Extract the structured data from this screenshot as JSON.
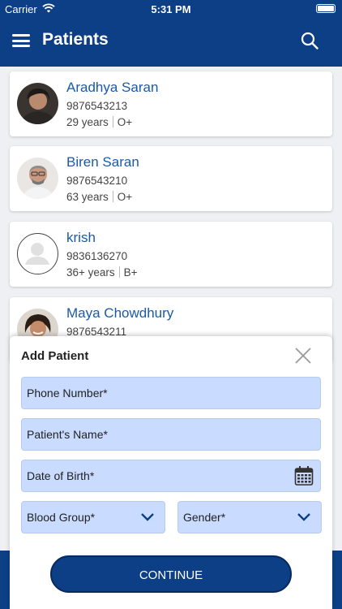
{
  "status_bar": {
    "carrier": "Carrier",
    "time": "5:31 PM"
  },
  "nav": {
    "title": "Patients"
  },
  "patients": [
    {
      "name": "Aradhya Saran",
      "phone": "9876543213",
      "age": "29 years",
      "blood": "O+"
    },
    {
      "name": "Biren Saran",
      "phone": "9876543210",
      "age": "63 years",
      "blood": "O+"
    },
    {
      "name": "krish",
      "phone": "9836136270",
      "age": "36+ years",
      "blood": "B+"
    },
    {
      "name": "Maya Chowdhury",
      "phone": "9876543211",
      "age": "",
      "blood": ""
    }
  ],
  "modal": {
    "title": "Add Patient",
    "phone_label": "Phone Number*",
    "name_label": "Patient's Name*",
    "dob_label": "Date of Birth*",
    "blood_label": "Blood Group*",
    "gender_label": "Gender*",
    "continue_label": "CONTINUE"
  },
  "colors": {
    "primary": "#0d3f86",
    "field_bg": "#c9dbff",
    "name_link": "#1a5aa6"
  }
}
